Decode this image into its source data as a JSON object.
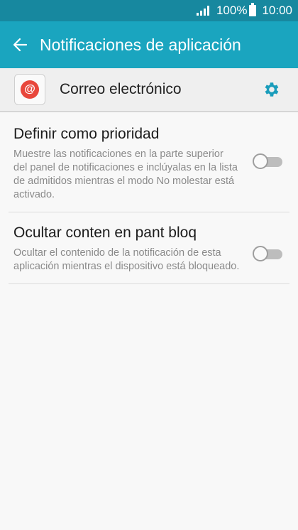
{
  "status_bar": {
    "battery_label": "100%",
    "time": "10:00",
    "icons": [
      "signal-icon",
      "battery-icon"
    ]
  },
  "app_bar": {
    "title": "Notificaciones de aplicación",
    "back_icon": "arrow-left-icon"
  },
  "app_header": {
    "app_name": "Correo electrónico",
    "app_icon": "email-app-icon",
    "settings_icon": "gear-icon"
  },
  "settings": [
    {
      "title": "Definir como prioridad",
      "description": "Muestre las notificaciones en la parte superior del panel de notificaciones e inclúyalas en la lista de admitidos mientras el modo No molestar está activado.",
      "enabled": false
    },
    {
      "title": "Ocultar conten en pant bloq",
      "description": "Ocultar el contenido de la notificación de esta aplicación mientras el dispositivo está bloqueado.",
      "enabled": false
    }
  ],
  "colors": {
    "status_bar": "#17889f",
    "app_bar": "#1aa5bf",
    "accent": "#1a9dbb",
    "email_icon": "#e8473c"
  }
}
